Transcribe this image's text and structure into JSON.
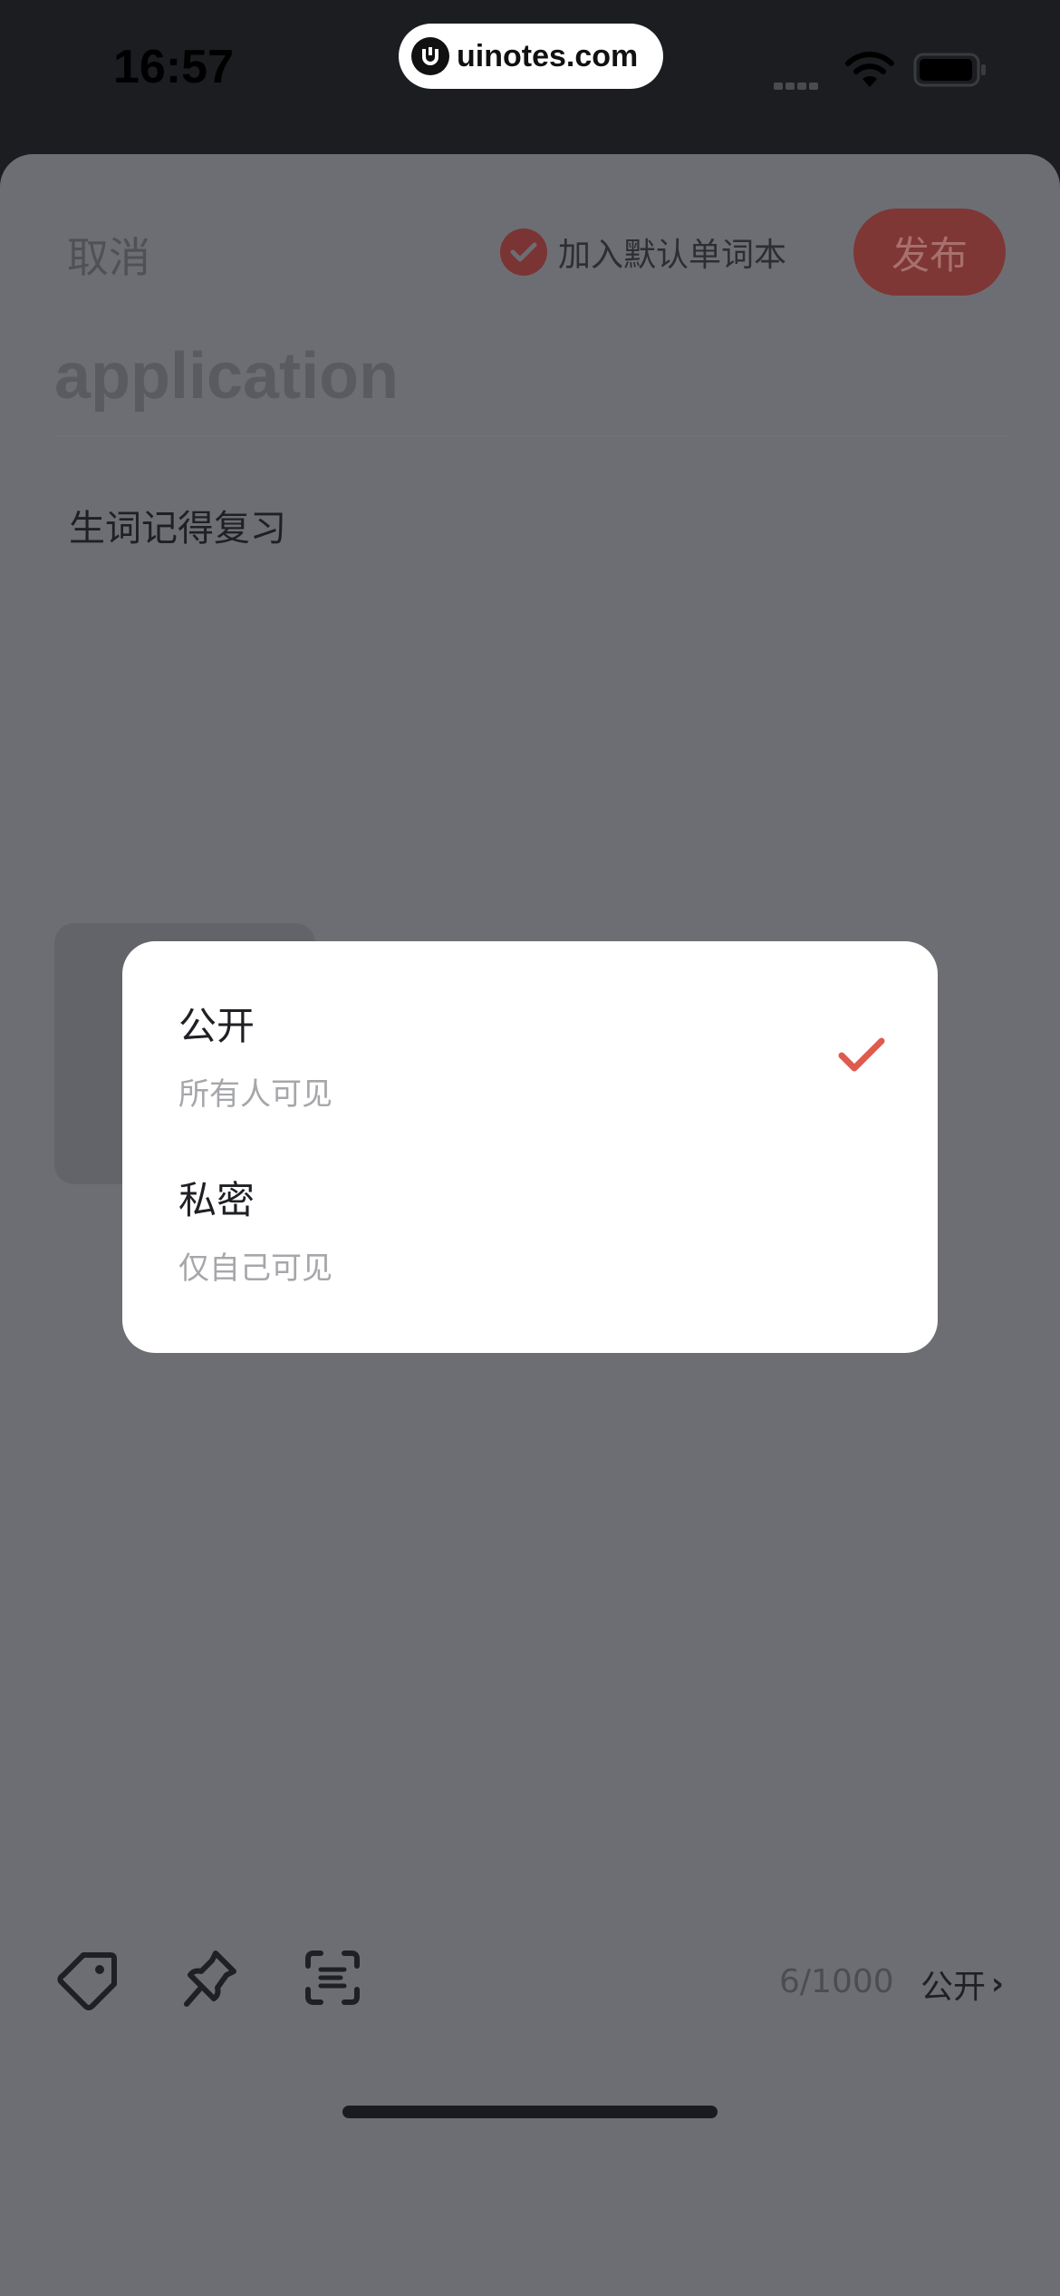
{
  "status_bar": {
    "time": "16:57",
    "watermark": "uinotes.com"
  },
  "editor": {
    "cancel_label": "取消",
    "add_to_default_label": "加入默认单词本",
    "add_to_default_checked": true,
    "publish_label": "发布",
    "word": "application",
    "note_text": "生词记得复习"
  },
  "toolbar": {
    "icons": [
      "tag-icon",
      "pin-icon",
      "scan-icon"
    ],
    "char_count": "6/1000",
    "visibility_label": "公开",
    "chevron": "›"
  },
  "visibility_dialog": {
    "options": [
      {
        "title": "公开",
        "subtitle": "所有人可见",
        "selected": true
      },
      {
        "title": "私密",
        "subtitle": "仅自己可见",
        "selected": false
      }
    ]
  },
  "colors": {
    "accent": "#e05a4e",
    "overlay": "#6d6e73",
    "publish_dim": "#7e3735"
  }
}
